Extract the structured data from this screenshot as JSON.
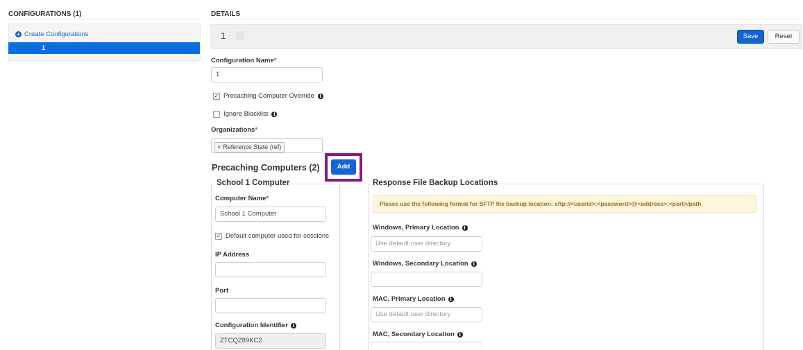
{
  "left": {
    "title": "CONFIGURATIONS (1)",
    "create_label": "Create Configurations",
    "selected_item": "1"
  },
  "details": {
    "title": "DETAILS",
    "config_number": "1",
    "save_label": "Save",
    "reset_label": "Reset",
    "config_name_label": "Configuration Name",
    "config_name_value": "1",
    "precaching_override_label": "Precaching Computer Override",
    "precaching_override_checked": true,
    "ignore_blacklist_label": "Ignore Blacklist",
    "ignore_blacklist_checked": false,
    "organizations_label": "Organizations",
    "organization_tag": "Reference State (ref)",
    "tag_remove": "×",
    "required_mark": "*"
  },
  "precaching": {
    "title": "Precaching Computers (2)",
    "add_label": "Add",
    "computer": {
      "legend": "School 1 Computer",
      "name_label": "Computer Name",
      "name_value": "School 1 Computer",
      "default_label": "Default computer used for sessions",
      "default_checked": true,
      "ip_label": "IP Address",
      "ip_value": "",
      "port_label": "Port",
      "port_value": "",
      "identifier_label": "Configuration Identifier",
      "identifier_value": "ZTCQZ89KC2"
    },
    "backup": {
      "legend": "Response File Backup Locations",
      "notice": "Please use the following format for SFTP file backup location: sftp://<userid>:<password>@<address>:<port>/path",
      "win_primary_label": "Windows, Primary Location",
      "win_primary_placeholder": "Use default user directory",
      "win_secondary_label": "Windows, Secondary Location",
      "mac_primary_label": "MAC, Primary Location",
      "mac_primary_placeholder": "Use default user directory",
      "mac_secondary_label": "MAC, Secondary Location"
    }
  },
  "icons": {
    "plus": "+",
    "info": "i",
    "check": "✓"
  },
  "colors": {
    "accent": "#0a6fdc",
    "button": "#1563d6",
    "highlight": "#8a1a7d",
    "warning_bg": "#fcf4dd",
    "warning_text": "#a36b10"
  }
}
